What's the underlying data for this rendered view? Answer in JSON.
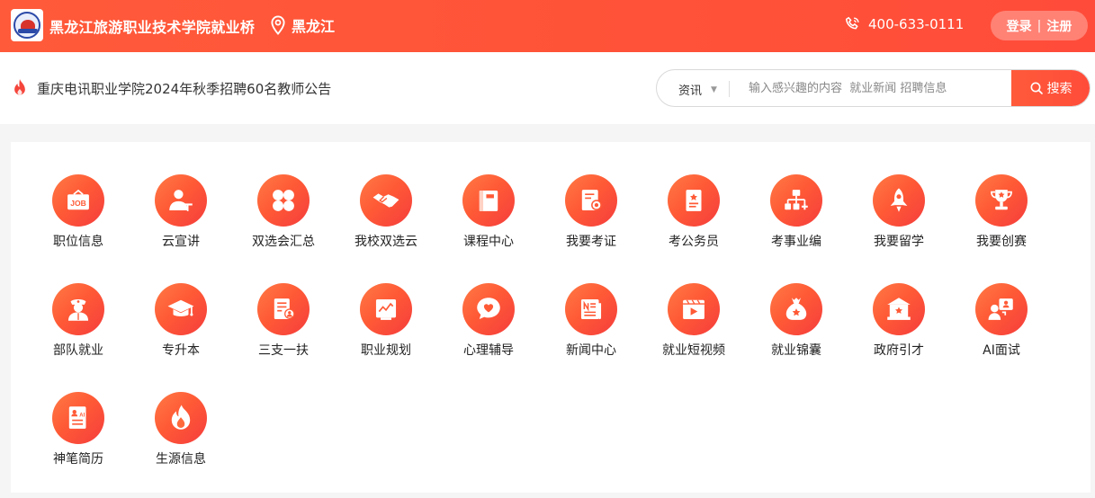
{
  "header": {
    "site_title": "黑龙江旅游职业技术学院就业桥",
    "location": "黑龙江",
    "phone": "400-633-0111",
    "login_label": "登录",
    "separator": "|",
    "register_label": "注册"
  },
  "notice": {
    "text": "重庆电讯职业学院2024年秋季招聘60名教师公告"
  },
  "search": {
    "category": "资讯",
    "placeholder": "输入感兴趣的内容  就业新闻 招聘信息",
    "button_label": "搜索"
  },
  "menu": {
    "items": [
      {
        "label": "职位信息",
        "icon": "job-sign-icon"
      },
      {
        "label": "云宣讲",
        "icon": "presenter-icon"
      },
      {
        "label": "双选会汇总",
        "icon": "four-petal-icon"
      },
      {
        "label": "我校双选云",
        "icon": "handshake-icon"
      },
      {
        "label": "课程中心",
        "icon": "book-icon"
      },
      {
        "label": "我要考证",
        "icon": "certificate-icon"
      },
      {
        "label": "考公务员",
        "icon": "document-star-icon"
      },
      {
        "label": "考事业编",
        "icon": "org-chart-icon"
      },
      {
        "label": "我要留学",
        "icon": "rocket-icon"
      },
      {
        "label": "我要创赛",
        "icon": "trophy-icon"
      },
      {
        "label": "部队就业",
        "icon": "soldier-icon"
      },
      {
        "label": "专升本",
        "icon": "graduation-cap-icon"
      },
      {
        "label": "三支一扶",
        "icon": "person-document-icon"
      },
      {
        "label": "职业规划",
        "icon": "chart-board-icon"
      },
      {
        "label": "心理辅导",
        "icon": "heart-bubble-icon"
      },
      {
        "label": "新闻中心",
        "icon": "newspaper-icon"
      },
      {
        "label": "就业短视频",
        "icon": "video-play-icon"
      },
      {
        "label": "就业锦囊",
        "icon": "money-bag-icon"
      },
      {
        "label": "政府引才",
        "icon": "government-building-icon"
      },
      {
        "label": "AI面试",
        "icon": "ai-interview-icon"
      },
      {
        "label": "神笔简历",
        "icon": "ai-resume-icon"
      },
      {
        "label": "生源信息",
        "icon": "flame-icon"
      }
    ]
  }
}
